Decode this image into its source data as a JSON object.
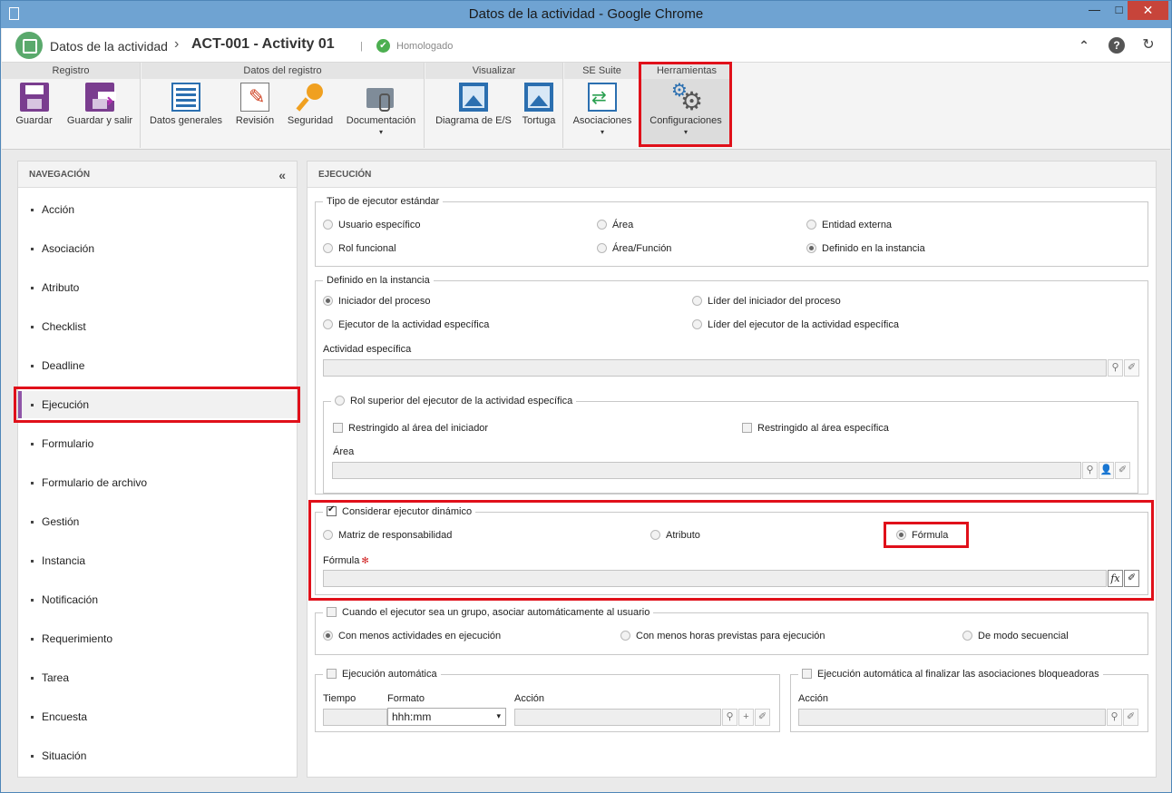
{
  "window": {
    "title": "Datos de la actividad - Google Chrome",
    "min": "—",
    "max": "□",
    "close": "✕"
  },
  "header": {
    "app_name": "Datos de la actividad",
    "separator": "›",
    "record_title": "ACT-001 - Activity 01",
    "divider": "|",
    "status": "Homologado",
    "status_icon": "✔",
    "up_icon": "⌃",
    "help_icon": "?",
    "refresh_icon": "↻"
  },
  "ribbon": {
    "groups": {
      "registro": "Registro",
      "datos": "Datos del registro",
      "visualizar": "Visualizar",
      "suite": "SE Suite",
      "herramientas": "Herramientas"
    },
    "buttons": {
      "guardar": "Guardar",
      "guardar_salir": "Guardar y salir",
      "datos_generales": "Datos generales",
      "revision": "Revisión",
      "seguridad": "Seguridad",
      "documentacion": "Documentación",
      "diagrama": "Diagrama de E/S",
      "tortuga": "Tortuga",
      "asociaciones": "Asociaciones",
      "configuraciones": "Configuraciones"
    },
    "caret": "▾"
  },
  "nav": {
    "title": "NAVEGACIÓN",
    "collapse": "«",
    "items": [
      "Acción",
      "Asociación",
      "Atributo",
      "Checklist",
      "Deadline",
      "Ejecución",
      "Formulario",
      "Formulario de archivo",
      "Gestión",
      "Instancia",
      "Notificación",
      "Requerimiento",
      "Tarea",
      "Encuesta",
      "Situación"
    ],
    "active": "Ejecución"
  },
  "main": {
    "title": "EJECUCIÓN",
    "tipo": {
      "legend": "Tipo de ejecutor estándar",
      "usuario": "Usuario específico",
      "area": "Área",
      "entidad": "Entidad externa",
      "rol": "Rol funcional",
      "area_funcion": "Área/Función",
      "definido": "Definido en la instancia"
    },
    "instancia": {
      "legend": "Definido en la instancia",
      "iniciador": "Iniciador del proceso",
      "lider_iniciador": "Líder del iniciador del proceso",
      "ejecutor": "Ejecutor de la actividad específica",
      "lider_ejecutor": "Líder del ejecutor de la actividad específica",
      "actividad_label": "Actividad específica",
      "rol_superior": "Rol superior del ejecutor de la actividad específica",
      "restringido_iniciador": "Restringido al área del iniciador",
      "restringido_especifica": "Restringido al área específica",
      "area_label": "Área"
    },
    "dinamico": {
      "legend": "Considerar ejecutor dinámico",
      "matriz": "Matriz de responsabilidad",
      "atributo": "Atributo",
      "formula": "Fórmula",
      "formula_label": "Fórmula",
      "required": "✻",
      "fx": "fx"
    },
    "grupo": {
      "legend": "Cuando el ejecutor sea un grupo, asociar automáticamente al usuario",
      "menos_actividades": "Con menos actividades en ejecución",
      "menos_horas": "Con menos horas previstas para ejecución",
      "secuencial": "De modo secuencial"
    },
    "automatica": {
      "legend": "Ejecución automática",
      "tiempo": "Tiempo",
      "formato": "Formato",
      "formato_value": "hhh:mm",
      "accion": "Acción"
    },
    "bloqueadoras": {
      "legend": "Ejecución automática al finalizar las asociaciones bloqueadoras",
      "accion": "Acción"
    },
    "icons": {
      "search": "⚲",
      "clear": "✐",
      "user": "👤",
      "add": "+"
    }
  },
  "colors": {
    "highlight": "#e0101a",
    "accent": "#8f55a8",
    "titlebar": "#6fa3d2"
  }
}
